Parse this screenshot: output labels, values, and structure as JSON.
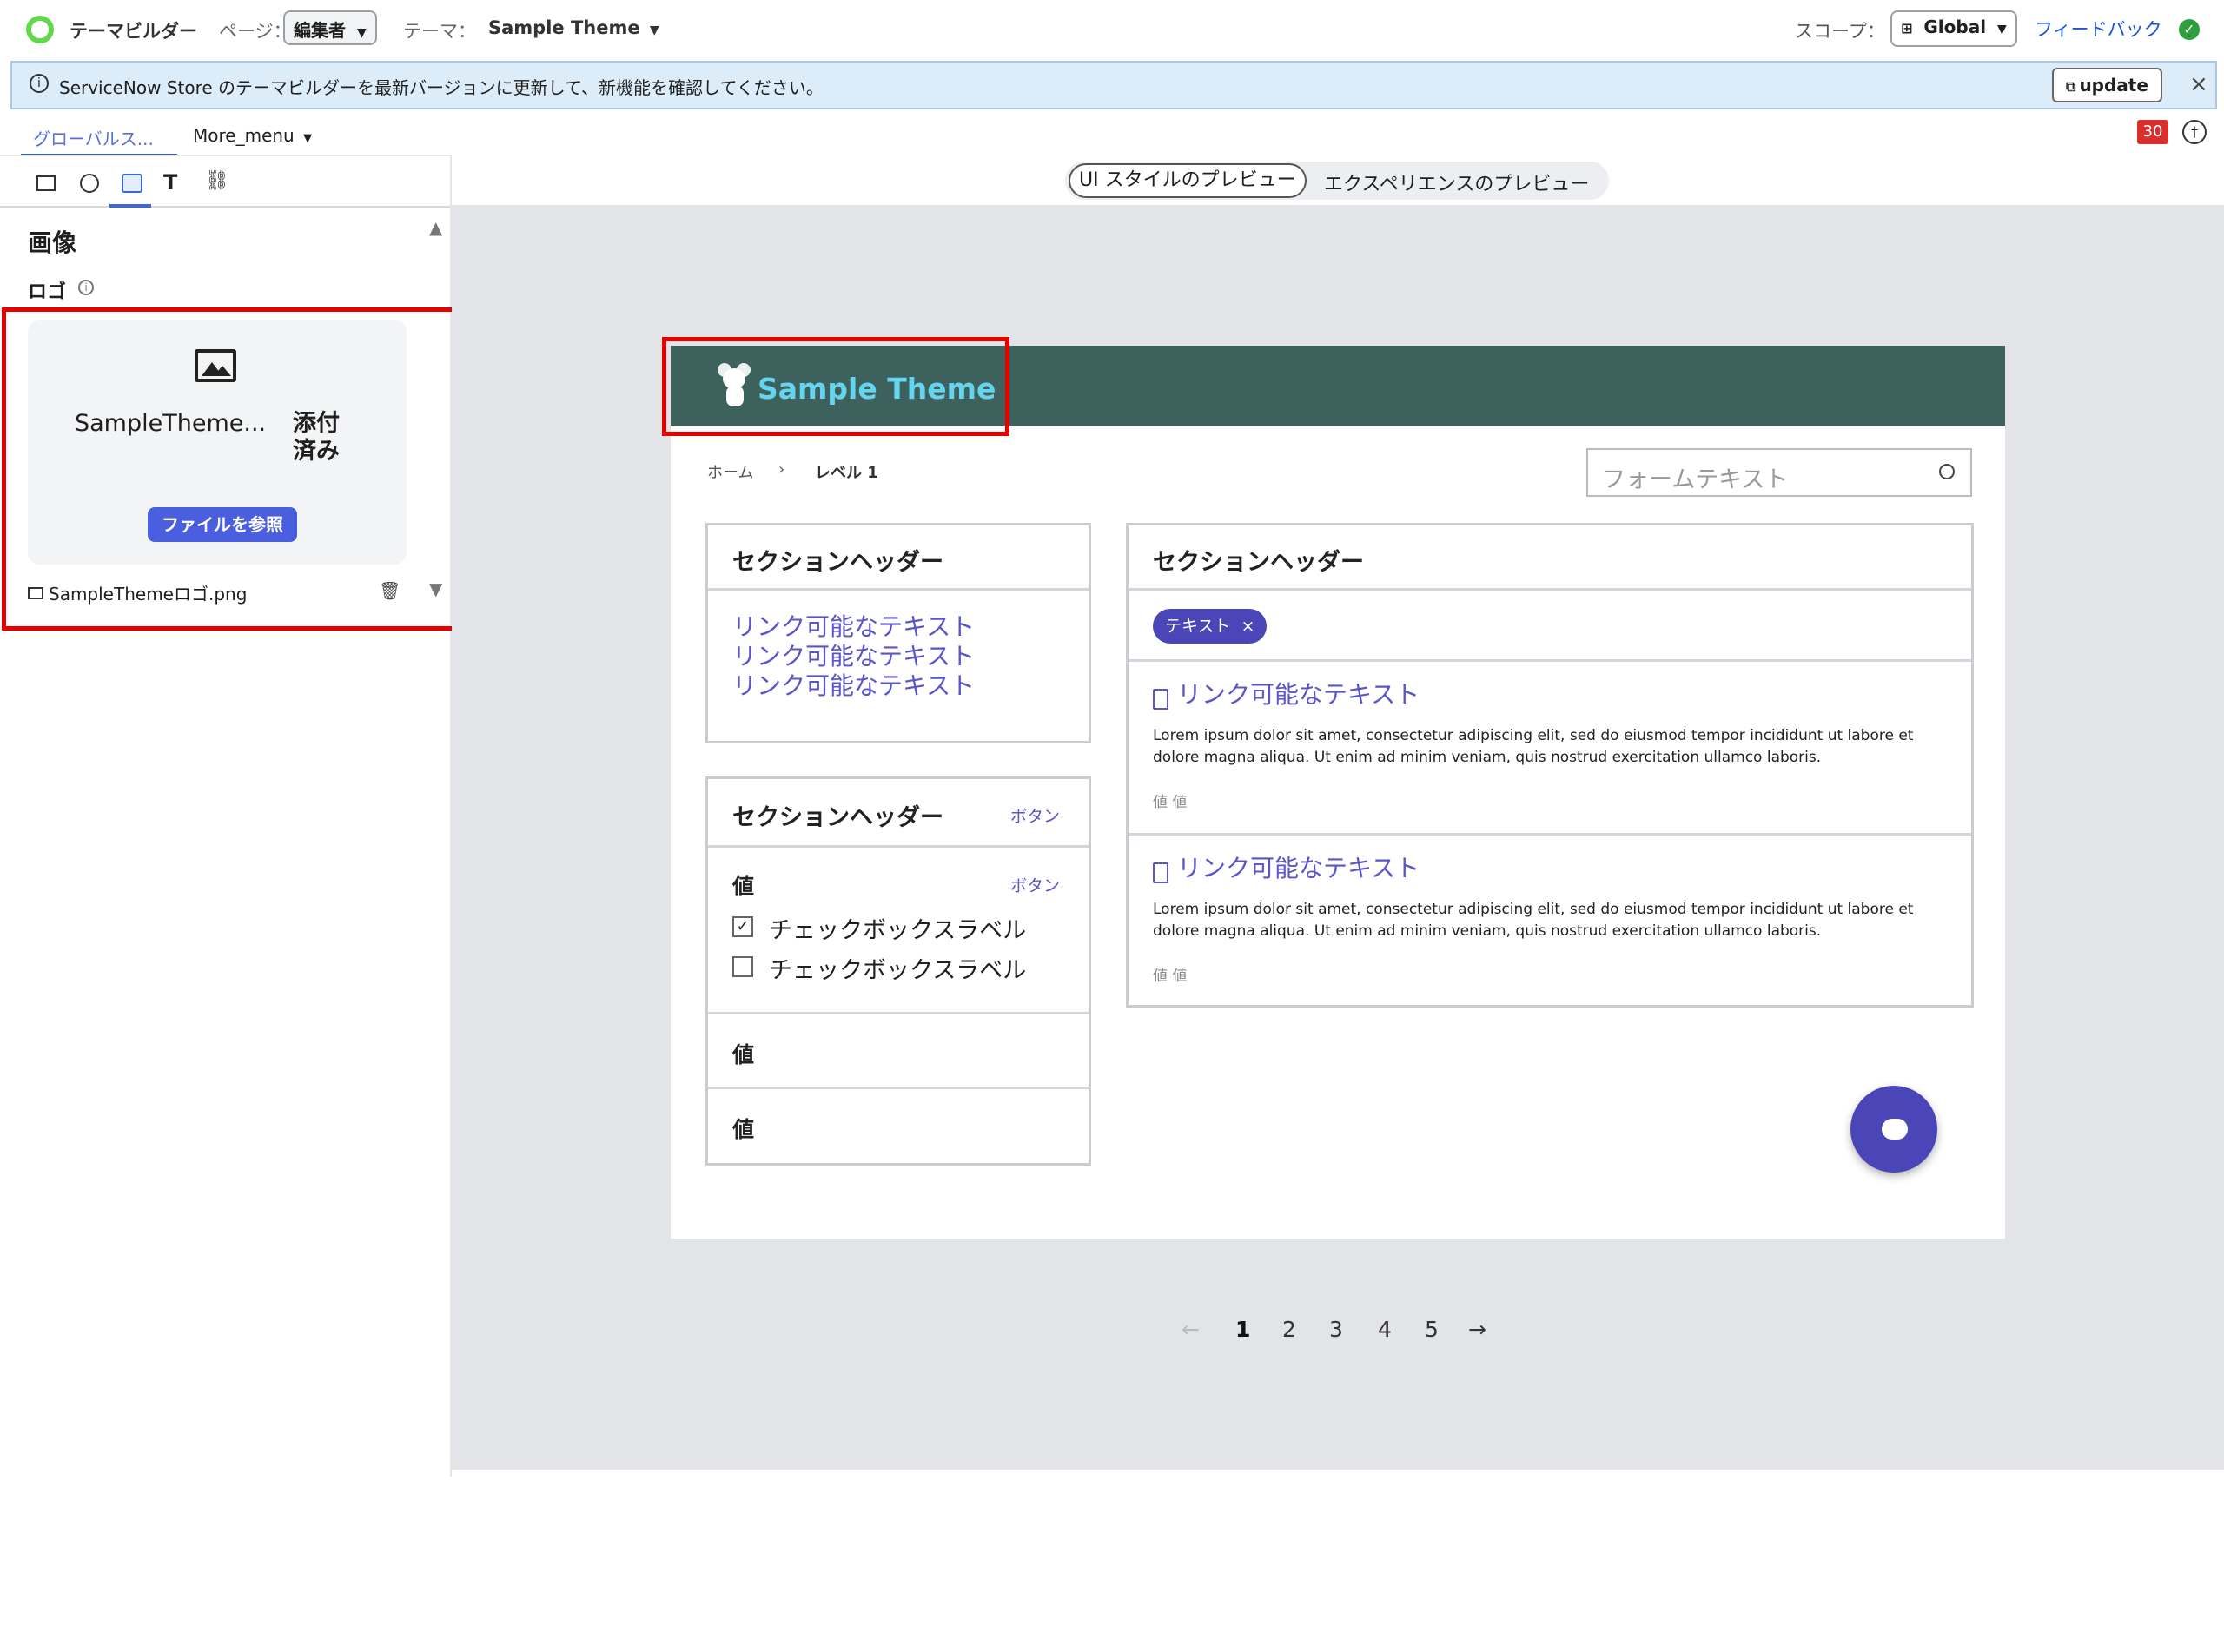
{
  "topbar": {
    "app_title": "テーマビルダー",
    "page_label": "ページ：",
    "page_value": "編集者",
    "theme_label": "テーマ：",
    "theme_value": "Sample Theme",
    "scope_label": "スコープ：",
    "scope_value": "Global",
    "feedback": "フィードバック"
  },
  "banner": {
    "text": "ServiceNow Store のテーマビルダーを最新バージョンに更新して、新機能を確認してください。",
    "update_button": "update"
  },
  "tabs": {
    "global": "グローバルス...",
    "more_menu": "More_menu",
    "badge_count": "30"
  },
  "preview_toggle": {
    "ui_style": "UI スタイルのプレビュー",
    "experience": "エクスペリエンスのプレビュー"
  },
  "left_panel": {
    "section_title": "画像",
    "logo_label": "ロゴ",
    "file_name_short": "SampleTheme...",
    "attached_status": "添付済み",
    "browse_button": "ファイルを参照",
    "file_name": "SampleThemeロゴ.png"
  },
  "preview": {
    "logo_text": "Sample Theme",
    "breadcrumb_home": "ホーム",
    "breadcrumb_level": "レベル 1",
    "search_placeholder": "フォームテキスト",
    "panel1": {
      "header": "セクションヘッダー",
      "links": [
        "リンク可能なテキスト",
        "リンク可能なテキスト",
        "リンク可能なテキスト"
      ]
    },
    "panel2": {
      "header": "セクションヘッダー",
      "header_button": "ボタン",
      "value_label": "値",
      "value_button": "ボタン",
      "checkbox1": "チェックボックスラベル",
      "checkbox2": "チェックボックスラベル",
      "value2": "値",
      "value3": "値"
    },
    "panel3": {
      "header": "セクションヘッダー",
      "chip": "テキスト",
      "item1_link": "リンク可能なテキスト",
      "item1_body": "Lorem ipsum dolor sit amet, consectetur adipiscing elit, sed do eiusmod tempor incididunt ut labore et dolore magna aliqua. Ut enim ad minim veniam, quis nostrud exercitation ullamco laboris.",
      "item1_meta": "値 値",
      "item2_link": "リンク可能なテキスト",
      "item2_body": "Lorem ipsum dolor sit amet, consectetur adipiscing elit, sed do eiusmod tempor incididunt ut labore et dolore magna aliqua. Ut enim ad minim veniam, quis nostrud exercitation ullamco laboris.",
      "item2_meta": "値 値"
    },
    "pagination": [
      "1",
      "2",
      "3",
      "4",
      "5"
    ]
  },
  "colors": {
    "header_bg": "#3d625e",
    "accent": "#5a55c8",
    "highlight_box": "#e60000",
    "banner_bg": "#dcecf8"
  }
}
